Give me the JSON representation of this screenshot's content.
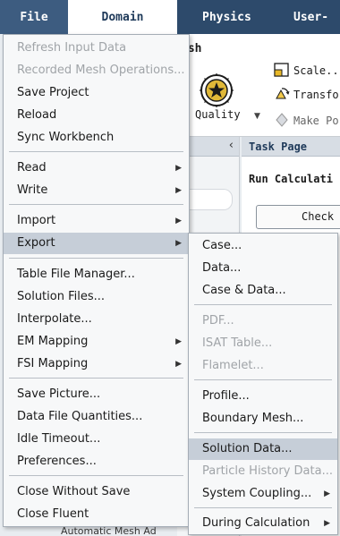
{
  "tabs": {
    "file": "File",
    "domain": "Domain",
    "physics": "Physics",
    "user_defined": "User-De"
  },
  "ribbon": {
    "mesh_title": "esh",
    "quality_label": "Quality",
    "scale": "Scale..",
    "transform": "Transfo",
    "make_poly": "Make Po"
  },
  "task_page": {
    "title": "Task Page",
    "run_calculation": "Run Calculati",
    "check": "Check",
    "tree_item": "Automatic Mesh Ad"
  },
  "file_menu": {
    "items": [
      {
        "label": "Refresh Input Data",
        "enabled": false
      },
      {
        "label": "Recorded Mesh Operations...",
        "enabled": false
      },
      {
        "label": "Save Project",
        "enabled": true
      },
      {
        "label": "Reload",
        "enabled": true
      },
      {
        "label": "Sync Workbench",
        "enabled": true
      },
      {
        "label": "Read",
        "enabled": true,
        "submenu": true
      },
      {
        "label": "Write",
        "enabled": true,
        "submenu": true
      },
      {
        "label": "Import",
        "enabled": true,
        "submenu": true
      },
      {
        "label": "Export",
        "enabled": true,
        "submenu": true,
        "highlighted": true
      },
      {
        "label": "Table File Manager...",
        "enabled": true
      },
      {
        "label": "Solution Files...",
        "enabled": true
      },
      {
        "label": "Interpolate...",
        "enabled": true
      },
      {
        "label": "EM Mapping",
        "enabled": true,
        "submenu": true
      },
      {
        "label": "FSI Mapping",
        "enabled": true,
        "submenu": true
      },
      {
        "label": "Save Picture...",
        "enabled": true
      },
      {
        "label": "Data File Quantities...",
        "enabled": true
      },
      {
        "label": "Idle Timeout...",
        "enabled": true
      },
      {
        "label": "Preferences...",
        "enabled": true
      },
      {
        "label": "Close Without Save",
        "enabled": true
      },
      {
        "label": "Close Fluent",
        "enabled": true
      }
    ]
  },
  "export_menu": {
    "items": [
      {
        "label": "Case...",
        "enabled": true
      },
      {
        "label": "Data...",
        "enabled": true
      },
      {
        "label": "Case & Data...",
        "enabled": true
      },
      {
        "label": "PDF...",
        "enabled": false
      },
      {
        "label": "ISAT Table...",
        "enabled": false
      },
      {
        "label": "Flamelet...",
        "enabled": false
      },
      {
        "label": "Profile...",
        "enabled": true
      },
      {
        "label": "Boundary Mesh...",
        "enabled": true
      },
      {
        "label": "Solution Data...",
        "enabled": true,
        "highlighted": true
      },
      {
        "label": "Particle History Data...",
        "enabled": false
      },
      {
        "label": "System Coupling...",
        "enabled": true,
        "submenu": true
      },
      {
        "label": "During Calculation",
        "enabled": true,
        "submenu": true
      }
    ]
  },
  "colors": {
    "title_bar": "#2d4a6b",
    "highlight": "#c6ced8",
    "disabled_text": "#a0a4a8"
  },
  "icons": {
    "submenu_arrow": "triangle-right-icon",
    "quality": "quality-gauge-icon",
    "scale": "scale-icon",
    "transform": "transform-icon",
    "make_poly": "make-polyhedra-icon",
    "collapse": "chevron-left-icon"
  }
}
